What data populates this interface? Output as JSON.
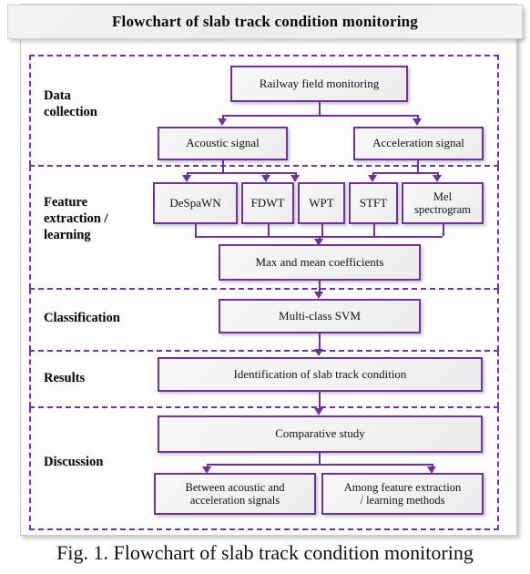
{
  "figure": {
    "banner_title": "Flowchart of slab track condition monitoring",
    "caption": "Fig. 1. Flowchart of slab track condition monitoring",
    "accent_color": "#7030A0",
    "band_border_color": "#7A2FAE",
    "node_fill_color": "#F2F2F2",
    "banner_fill_color": "#EFEFEF"
  },
  "stages": [
    {
      "label": "Data\ncollection"
    },
    {
      "label": "Feature\nextraction /\nlearning"
    },
    {
      "label": "Classification"
    },
    {
      "label": "Results"
    },
    {
      "label": "Discussion"
    }
  ],
  "stage_labels": {
    "data_collection_line1": "Data",
    "data_collection_line2": "collection",
    "feature_line1": "Feature",
    "feature_line2": "extraction /",
    "feature_line3": "learning",
    "classification": "Classification",
    "results": "Results",
    "discussion": "Discussion"
  },
  "nodes": {
    "railway_field_monitoring": "Railway field monitoring",
    "acoustic_signal": "Acoustic signal",
    "acceleration_signal": "Acceleration signal",
    "despawn": "DeSpaWN",
    "fdwt": "FDWT",
    "wpt": "WPT",
    "stft": "STFT",
    "mel_spectrogram_line1": "Mel",
    "mel_spectrogram_line2": "spectrogram",
    "max_mean_coefficients": "Max and mean coefficients",
    "multi_class_svm": "Multi-class SVM",
    "identification": "Identification of slab track condition",
    "comparative_study": "Comparative study",
    "between_signals_line1": "Between acoustic and",
    "between_signals_line2": "acceleration signals",
    "among_methods_line1": "Among feature extraction",
    "among_methods_line2": "/ learning methods"
  },
  "chart_data": {
    "type": "diagram",
    "title": "Flowchart of slab track condition monitoring",
    "stages": [
      {
        "name": "Data collection",
        "nodes": [
          "Railway field monitoring",
          "Acoustic signal",
          "Acceleration signal"
        ]
      },
      {
        "name": "Feature extraction / learning",
        "nodes": [
          "DeSpaWN",
          "FDWT",
          "WPT",
          "STFT",
          "Mel spectrogram",
          "Max and mean coefficients"
        ]
      },
      {
        "name": "Classification",
        "nodes": [
          "Multi-class SVM"
        ]
      },
      {
        "name": "Results",
        "nodes": [
          "Identification of slab track condition"
        ]
      },
      {
        "name": "Discussion",
        "nodes": [
          "Comparative study",
          "Between acoustic and acceleration signals",
          "Among feature extraction / learning methods"
        ]
      }
    ],
    "edges": [
      [
        "Railway field monitoring",
        "Acoustic signal"
      ],
      [
        "Railway field monitoring",
        "Acceleration signal"
      ],
      [
        "Acoustic signal",
        "DeSpaWN"
      ],
      [
        "Acoustic signal",
        "FDWT"
      ],
      [
        "Acoustic signal",
        "WPT"
      ],
      [
        "Acceleration signal",
        "STFT"
      ],
      [
        "Acceleration signal",
        "Mel spectrogram"
      ],
      [
        "DeSpaWN",
        "Max and mean coefficients"
      ],
      [
        "FDWT",
        "Max and mean coefficients"
      ],
      [
        "WPT",
        "Max and mean coefficients"
      ],
      [
        "STFT",
        "Max and mean coefficients"
      ],
      [
        "Mel spectrogram",
        "Max and mean coefficients"
      ],
      [
        "Max and mean coefficients",
        "Multi-class SVM"
      ],
      [
        "Multi-class SVM",
        "Identification of slab track condition"
      ],
      [
        "Identification of slab track condition",
        "Comparative study"
      ],
      [
        "Comparative study",
        "Between acoustic and acceleration signals"
      ],
      [
        "Comparative study",
        "Among feature extraction / learning methods"
      ]
    ]
  }
}
